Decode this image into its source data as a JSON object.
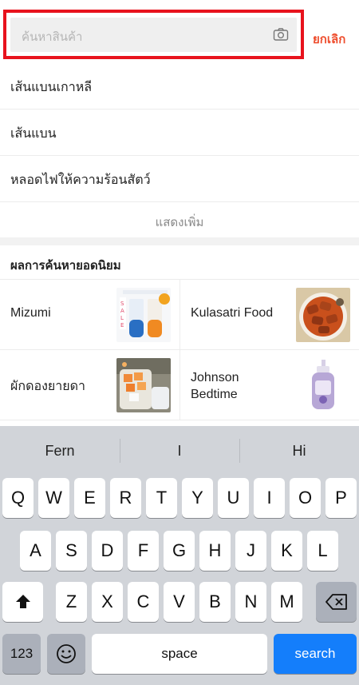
{
  "search": {
    "placeholder": "ค้นหาสินค้า",
    "cancel_label": "ยกเลิก",
    "highlight_color": "#e8131d",
    "accent": "#ee4d2d"
  },
  "suggestions": [
    "เส้นแบนเกาหลี",
    "เส้นแบน",
    "หลอดไฟให้ความร้อนสัตว์"
  ],
  "show_more_label": "แสดงเพิ่ม",
  "popular": {
    "title": "ผลการค้นหายอดนิยม",
    "items": [
      {
        "label": "Mizumi"
      },
      {
        "label": "Kulasatri Food"
      },
      {
        "label": "ผักดองยายดา"
      },
      {
        "label": "Johnson Bedtime"
      }
    ]
  },
  "keyboard": {
    "predictions": [
      "Fern",
      "I",
      "Hi"
    ],
    "row1": [
      "Q",
      "W",
      "E",
      "R",
      "T",
      "Y",
      "U",
      "I",
      "O",
      "P"
    ],
    "row2": [
      "A",
      "S",
      "D",
      "F",
      "G",
      "H",
      "J",
      "K",
      "L"
    ],
    "row3": [
      "Z",
      "X",
      "C",
      "V",
      "B",
      "N",
      "M"
    ],
    "numbers_label": "123",
    "space_label": "space",
    "search_label": "search",
    "search_color": "#147efb"
  }
}
